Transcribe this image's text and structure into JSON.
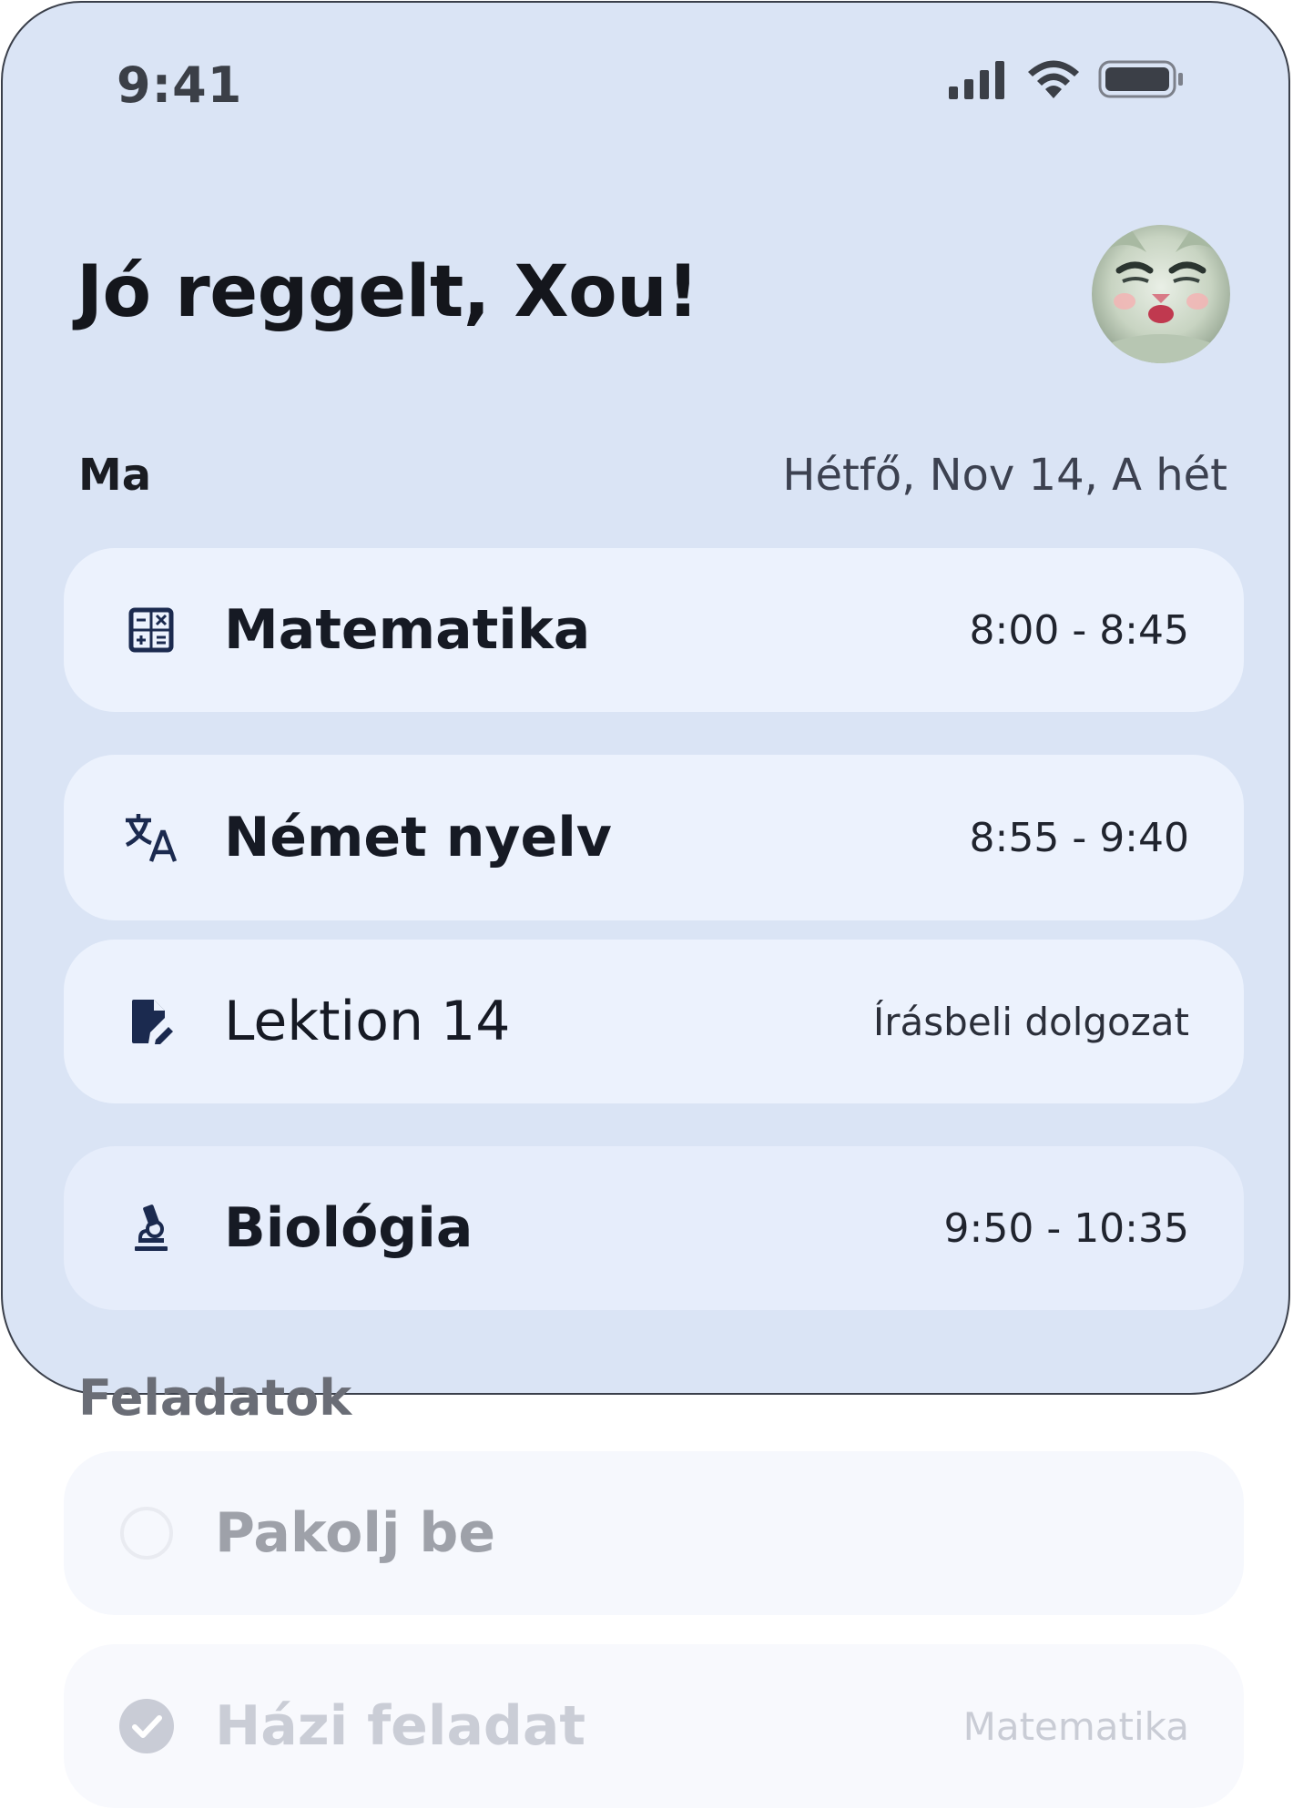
{
  "status_bar": {
    "time": "9:41",
    "icons": [
      "signal-icon",
      "wifi-icon",
      "battery-icon"
    ]
  },
  "header": {
    "greeting": "Jó reggelt, Xou!",
    "avatar_icon": "avatar"
  },
  "today": {
    "label": "Ma",
    "date": "Hétfő, Nov 14, A hét"
  },
  "schedule": [
    {
      "icon": "calculator-icon",
      "title": "Matematika",
      "meta": "8:00 - 8:45"
    },
    {
      "icon": "translate-icon",
      "title": "Német nyelv",
      "meta": "8:55 - 9:40"
    },
    {
      "icon": "edit-document-icon",
      "title": "Lektion 14",
      "meta": "Írásbeli dolgozat"
    },
    {
      "icon": "microscope-icon",
      "title": "Biológia",
      "meta": "9:50 - 10:35"
    }
  ],
  "tasks": {
    "heading": "Feladatok",
    "items": [
      {
        "title": "Pakolj be",
        "meta": "",
        "done": false
      },
      {
        "title": "Házi feladat",
        "meta": "Matematika",
        "done": true
      }
    ]
  },
  "colors": {
    "panel_background": "#dae4f5",
    "card_background": "#ecf2fd",
    "icon_color": "#1b2a4f",
    "text_dark": "#161a24"
  }
}
